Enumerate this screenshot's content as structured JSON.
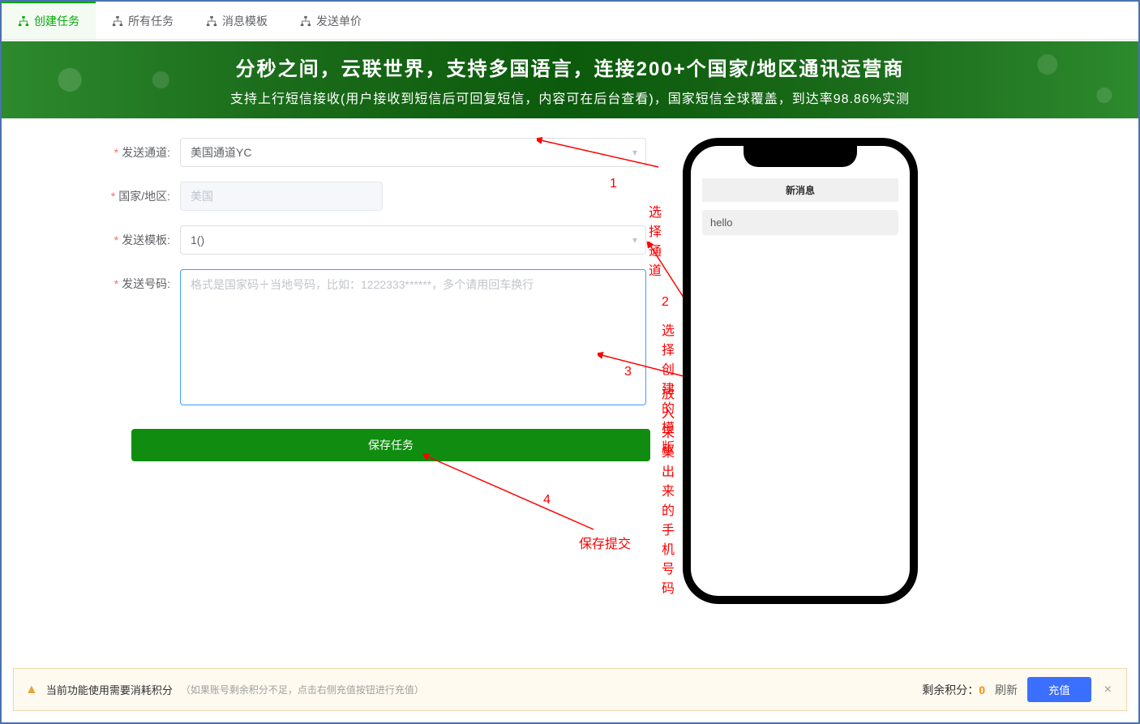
{
  "tabs": [
    {
      "label": "创建任务",
      "active": true
    },
    {
      "label": "所有任务",
      "active": false
    },
    {
      "label": "消息模板",
      "active": false
    },
    {
      "label": "发送单价",
      "active": false
    }
  ],
  "banner": {
    "title": "分秒之间，云联世界，支持多国语言，连接200+个国家/地区通讯运营商",
    "subtitle": "支持上行短信接收(用户接收到短信后可回复短信，内容可在后台查看)，国家短信全球覆盖，到达率98.86%实测"
  },
  "form": {
    "channel": {
      "label": "发送通道:",
      "value": "美国通道YC"
    },
    "country": {
      "label": "国家/地区:",
      "value": "美国"
    },
    "template": {
      "label": "发送模板:",
      "value": "1()"
    },
    "numbers": {
      "label": "发送号码:",
      "placeholder": "格式是国家码＋当地号码，比如：1222333******，多个请用回车换行"
    },
    "saveBtn": "保存任务"
  },
  "annotations": {
    "a1num": "1",
    "a1": "选择通道",
    "a2num": "2",
    "a2": "选择创建的模版",
    "a3num": "3",
    "a3": "放入采集出来的手机号码",
    "a4num": "4",
    "a4": "保存提交"
  },
  "phone": {
    "header": "新消息",
    "message": "hello"
  },
  "footer": {
    "warnMain": "当前功能使用需要消耗积分",
    "warnSub": "（如果账号剩余积分不足，点击右侧充值按钮进行充值）",
    "pointsLabel": "剩余积分：",
    "pointsValue": "0",
    "refresh": "刷新",
    "recharge": "充值"
  }
}
